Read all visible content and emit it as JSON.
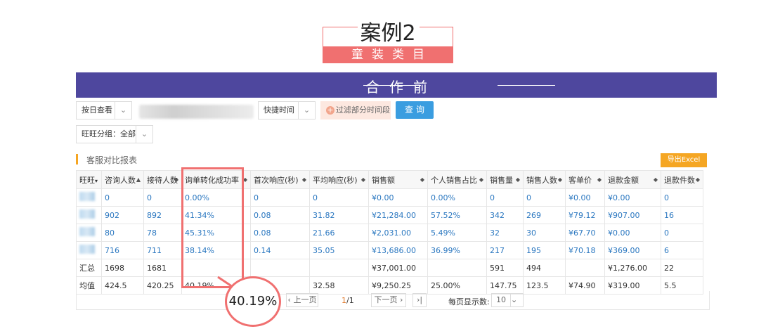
{
  "header": {
    "title": "案例2",
    "subtitle": "童装类目"
  },
  "banner": {
    "title": "合作前"
  },
  "filters": {
    "view_mode": "按日查看",
    "quick_time": "快捷时间",
    "filter_periods": "过滤部分时间段",
    "query": "查询",
    "group": "旺旺分组：全部"
  },
  "section": {
    "title": "客服对比报表",
    "export": "导出Excel"
  },
  "table": {
    "headers": [
      "旺旺",
      "咨询人数",
      "接待人数",
      "询单转化成功率",
      "首次响应(秒)",
      "平均响应(秒)",
      "销售额",
      "个人销售占比",
      "销售量",
      "销售人数",
      "客单价",
      "退款金额",
      "退款件数"
    ],
    "rows": [
      [
        "",
        "0",
        "0",
        "0.00%",
        "0",
        "0",
        "¥0.00",
        "0.00%",
        "0",
        "0",
        "¥0.00",
        "¥0.00",
        "0"
      ],
      [
        "",
        "902",
        "892",
        "41.34%",
        "0.08",
        "31.82",
        "¥21,284.00",
        "57.52%",
        "342",
        "269",
        "¥79.12",
        "¥907.00",
        "16"
      ],
      [
        "",
        "80",
        "78",
        "45.31%",
        "0.08",
        "21.66",
        "¥2,031.00",
        "5.49%",
        "32",
        "30",
        "¥67.70",
        "¥0.00",
        "0"
      ],
      [
        "",
        "716",
        "711",
        "38.14%",
        "0.14",
        "35.05",
        "¥13,686.00",
        "36.99%",
        "217",
        "195",
        "¥70.18",
        "¥369.00",
        "6"
      ]
    ],
    "summary": [
      "汇总",
      "1698",
      "1681",
      "",
      "",
      "",
      "¥37,001.00",
      "",
      "591",
      "494",
      "",
      "¥1,276.00",
      "22"
    ],
    "average": [
      "均值",
      "424.5",
      "420.25",
      "40.19%",
      "",
      "32.58",
      "¥9,250.25",
      "25.00%",
      "147.75",
      "123.5",
      "¥74.90",
      "¥319.00",
      "5.5"
    ]
  },
  "pager": {
    "prev": "上一页",
    "current": "1",
    "total": "/1",
    "next": "下一页",
    "per_page_label": "每页显示数:",
    "per_page": "10"
  },
  "callout": {
    "value": "40.19%"
  },
  "colors": {
    "accent": "#f07070",
    "banner": "#4e479e",
    "link": "#2a77c0",
    "query": "#3a9de0",
    "export": "#f5a623"
  }
}
